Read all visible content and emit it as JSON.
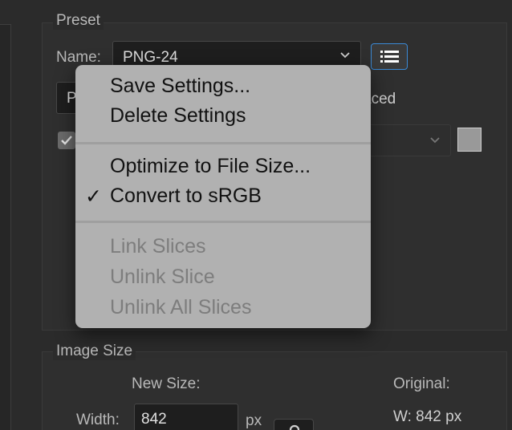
{
  "preset": {
    "title": "Preset",
    "name_label": "Name:",
    "name_value": "PNG-24",
    "format_value": "P",
    "interlaced_label": "aced"
  },
  "image_size": {
    "title": "Image Size",
    "new_size_label": "New Size:",
    "original_label": "Original:",
    "width_label": "Width:",
    "width_value": "842",
    "width_unit": "px",
    "original_width": "W:  842 px"
  },
  "menu": {
    "items": [
      {
        "label": "Save Settings...",
        "enabled": true
      },
      {
        "label": "Delete Settings",
        "enabled": true
      },
      {
        "label": "Optimize to File Size...",
        "enabled": true
      },
      {
        "label": "Convert to sRGB",
        "enabled": true,
        "checked": true
      },
      {
        "label": "Link Slices",
        "enabled": false
      },
      {
        "label": "Unlink Slice",
        "enabled": false
      },
      {
        "label": "Unlink All Slices",
        "enabled": false
      }
    ],
    "checkmark": "✓"
  },
  "icons": {
    "menu_button": "list-menu-icon",
    "dropdown": "chevron-down-icon",
    "link": "link-icon",
    "check": "checkmark-icon"
  },
  "colors": {
    "accent": "#3b8ad6",
    "matte": "#999999",
    "menu_bg": "#b1b1b1"
  }
}
